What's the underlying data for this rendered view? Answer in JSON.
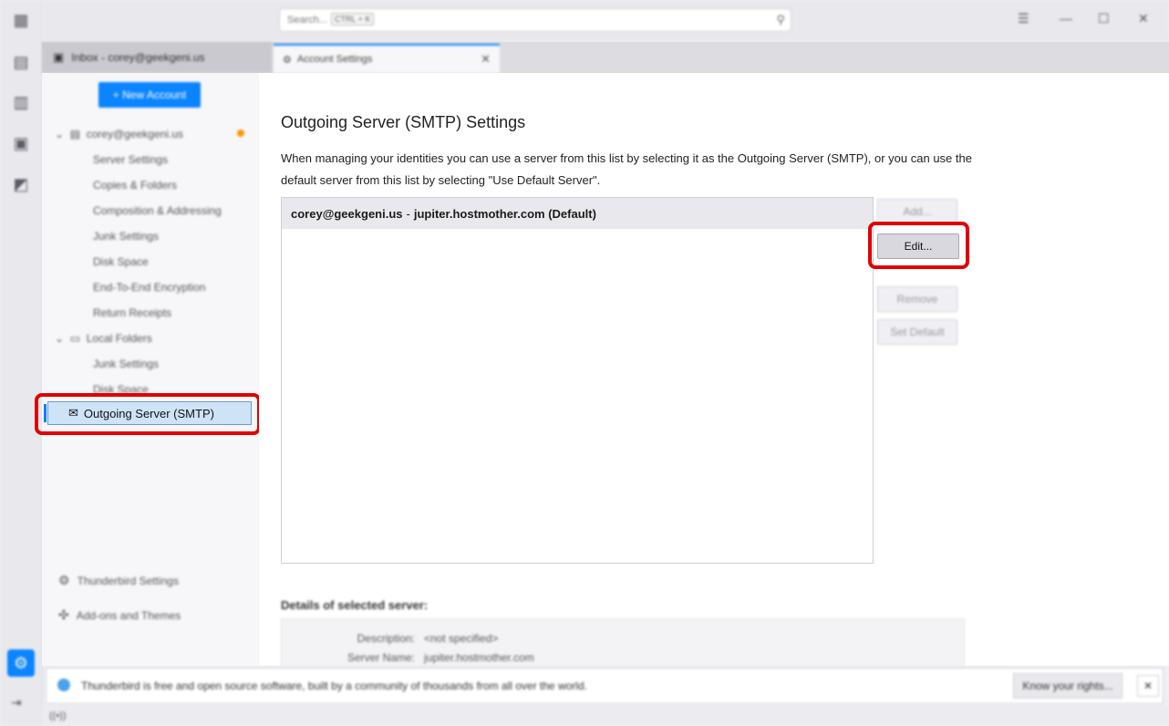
{
  "search": {
    "placeholder": "Search...",
    "shortcut": "CTRL + K"
  },
  "window_controls": {
    "menu": "☰",
    "minimize": "—",
    "maximize": "☐",
    "close": "✕"
  },
  "tabs": [
    {
      "label": "Inbox - corey@geekgeni.us"
    },
    {
      "label": "Account Settings",
      "close": "✕"
    }
  ],
  "sidebar": {
    "new_account": "+ New Account",
    "accounts": [
      {
        "name": "corey@geekgeni.us",
        "items": [
          "Server Settings",
          "Copies & Folders",
          "Composition & Addressing",
          "Junk Settings",
          "Disk Space",
          "End-To-End Encryption",
          "Return Receipts"
        ]
      },
      {
        "name": "Local Folders",
        "items": [
          "Junk Settings",
          "Disk Space"
        ]
      }
    ],
    "selected": "Outgoing Server (SMTP)",
    "footer": {
      "settings": "Thunderbird Settings",
      "addons": "Add-ons and Themes"
    }
  },
  "main": {
    "title": "Outgoing Server (SMTP) Settings",
    "description": "When managing your identities you can use a server from this list by selecting it as the Outgoing Server (SMTP), or you can use the default server from this list by selecting \"Use Default Server\".",
    "server_row": {
      "account": "corey@geekgeni.us",
      "separator": "-",
      "server": "jupiter.hostmother.com (Default)"
    },
    "buttons": {
      "add": "Add...",
      "edit": "Edit...",
      "remove": "Remove",
      "set_default": "Set Default"
    },
    "details": {
      "title": "Details of selected server:",
      "rows": [
        {
          "label": "Description:",
          "value": "<not specified>"
        },
        {
          "label": "Server Name:",
          "value": "jupiter.hostmother.com"
        }
      ]
    }
  },
  "notification": {
    "message": "Thunderbird is free and open source software, built by a community of thousands from all over the world.",
    "button": "Know your rights...",
    "close": "✕"
  },
  "status": {
    "icon": "((•))"
  },
  "colors": {
    "accent": "#0a84ff",
    "highlight": "#e00000",
    "selected_bg": "#cfe3f7"
  }
}
